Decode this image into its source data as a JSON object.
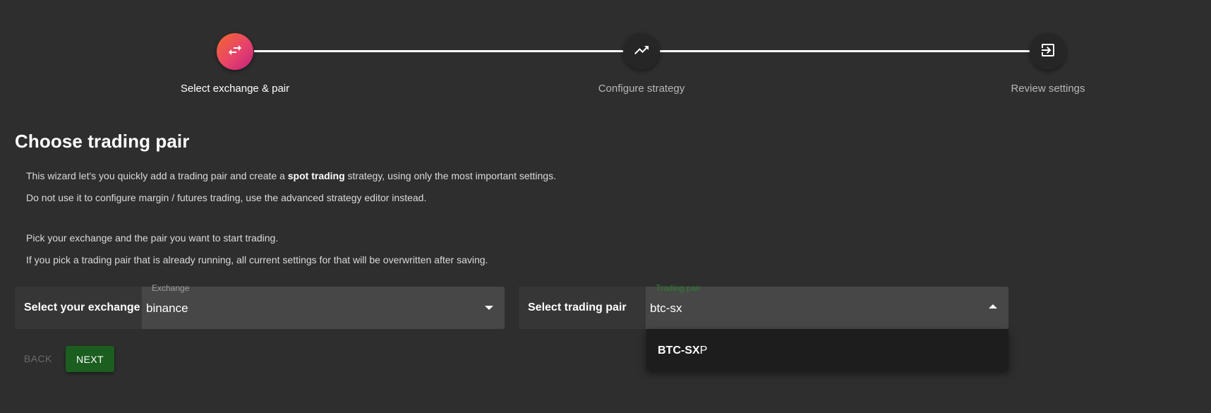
{
  "stepper": {
    "steps": [
      {
        "label": "Select exchange & pair",
        "icon": "swap-arrows-icon",
        "active": true
      },
      {
        "label": "Configure strategy",
        "icon": "trending-up-icon",
        "active": false
      },
      {
        "label": "Review settings",
        "icon": "exit-to-app-icon",
        "active": false
      }
    ]
  },
  "main": {
    "title": "Choose trading pair",
    "intro_prefix": "This wizard let's you quickly add a trading pair and create a ",
    "intro_bold": "spot trading",
    "intro_suffix": " strategy, using only the most important settings.",
    "line2": "Do not use it to configure margin / futures trading, use the advanced strategy editor instead.",
    "line3": "Pick your exchange and the pair you want to start trading.",
    "line4": "If you pick a trading pair that is already running, all current settings for that will be overwritten after saving."
  },
  "exchange_select": {
    "label": "Select your exchange",
    "field_label": "Exchange",
    "value": "binance"
  },
  "pair_select": {
    "label": "Select trading pair",
    "field_label": "Trading pair",
    "value": "btc-sx",
    "options": [
      {
        "match": "BTC-SX",
        "rest": "P"
      }
    ]
  },
  "actions": {
    "back_label": "BACK",
    "next_label": "NEXT"
  },
  "colors": {
    "background": "#2e2e2e",
    "active_gradient_start": "#f26a2e",
    "active_gradient_end": "#c1227f",
    "primary_button": "#1b5e20",
    "focus_label": "#2e7d32"
  }
}
